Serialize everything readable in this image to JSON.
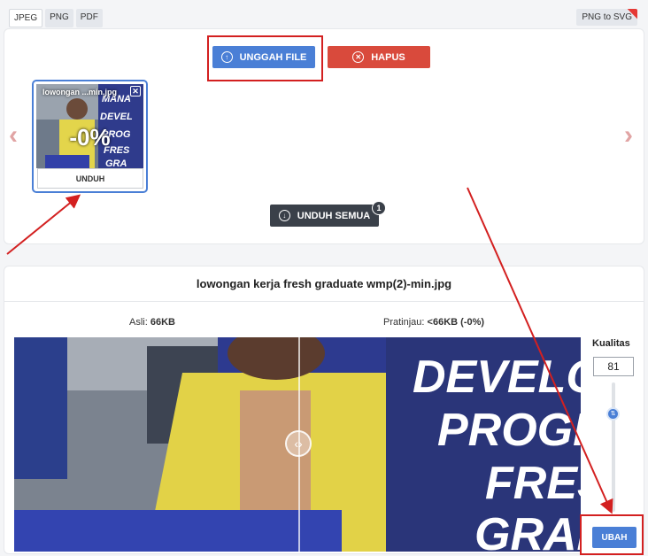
{
  "tabs": [
    {
      "label": "JPEG",
      "active": true
    },
    {
      "label": "PNG",
      "active": false
    },
    {
      "label": "PDF",
      "active": false
    }
  ],
  "svg_tab": "PNG to SVG",
  "buttons": {
    "upload": "UNGGAH FILE",
    "delete": "HAPUS",
    "download_all": "UNDUH SEMUA",
    "download_all_badge": "1",
    "apply": "UBAH"
  },
  "thumbnail": {
    "filename": "lowongan ...min.jpg",
    "reduction": "-0%",
    "download": "UNDUH",
    "image_text": "MANA DEVEL PROG FRES GRA"
  },
  "preview": {
    "title": "lowongan kerja fresh graduate wmp(2)-min.jpg",
    "original_label": "Asli:",
    "original_size": "66KB",
    "preview_label": "Pratinjau:",
    "preview_size": "<66KB (-0%)",
    "image_text": [
      "DEVELOP",
      "PROGRA",
      "FRESH",
      "GRADU"
    ]
  },
  "quality": {
    "label": "Kualitas",
    "value": "81",
    "level_percent": 81
  },
  "colors": {
    "accent": "#4a7fd6",
    "danger": "#d94a3c",
    "dark": "#3a4049",
    "annotation": "#d32020"
  }
}
